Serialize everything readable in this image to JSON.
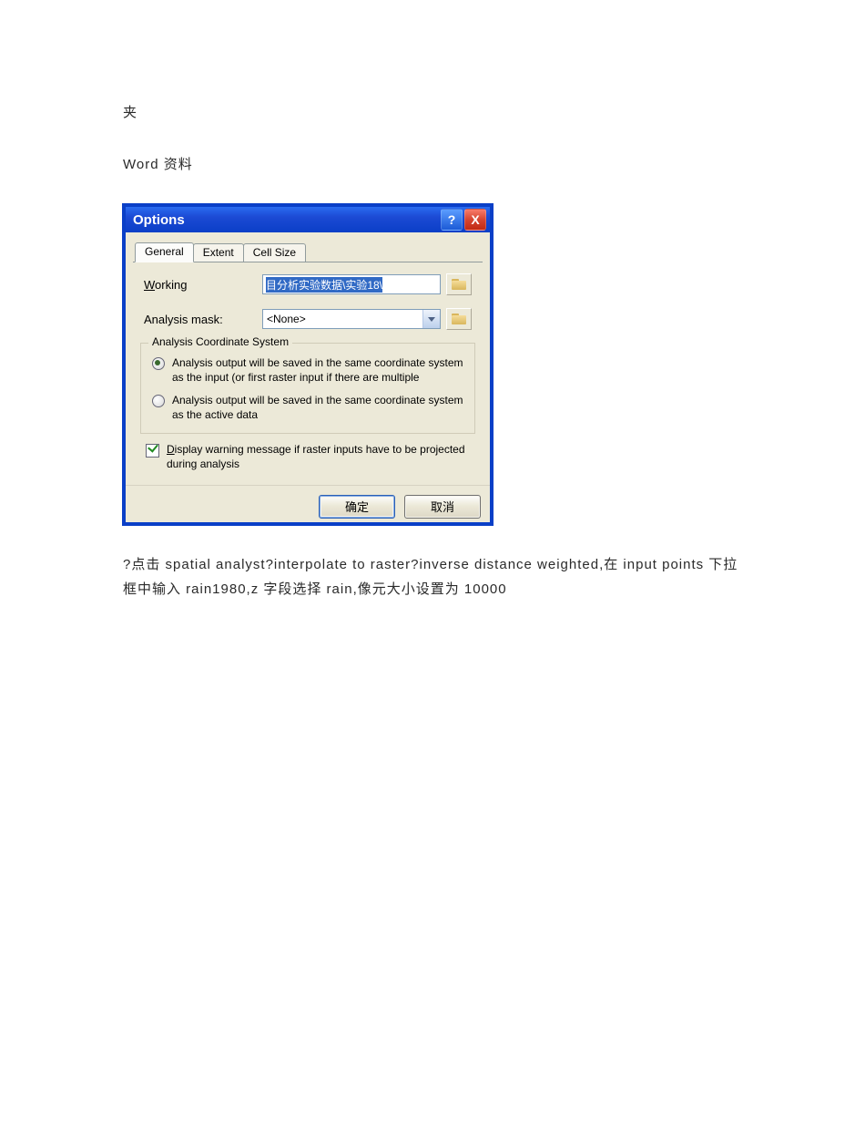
{
  "doc": {
    "line1": "夹",
    "line2": "Word 资料",
    "body": "?点击 spatial analyst?interpolate to raster?inverse distance weighted,在 input points 下拉框中输入 rain1980,z 字段选择 rain,像元大小设置为 10000"
  },
  "dialog": {
    "title": "Options",
    "help_label": "?",
    "close_label": "X",
    "tabs": {
      "general": "General",
      "extent": "Extent",
      "cellsize": "Cell Size"
    },
    "fields": {
      "working_label_pre": "W",
      "working_label_post": "orking",
      "working_value": "目分析实验数据\\实验18\\",
      "mask_label": "Analysis mask:",
      "mask_value": "<None>"
    },
    "group": {
      "legend": "Analysis Coordinate System",
      "opt1": "Analysis output will be saved in the same coordinate system as the input (or first raster input if there are multiple",
      "opt2": "Analysis output will be saved in the same coordinate system as the active data"
    },
    "warn_pre": "D",
    "warn_post": "isplay warning message if raster inputs have to be projected during analysis",
    "buttons": {
      "ok": "确定",
      "cancel": "取消"
    }
  }
}
